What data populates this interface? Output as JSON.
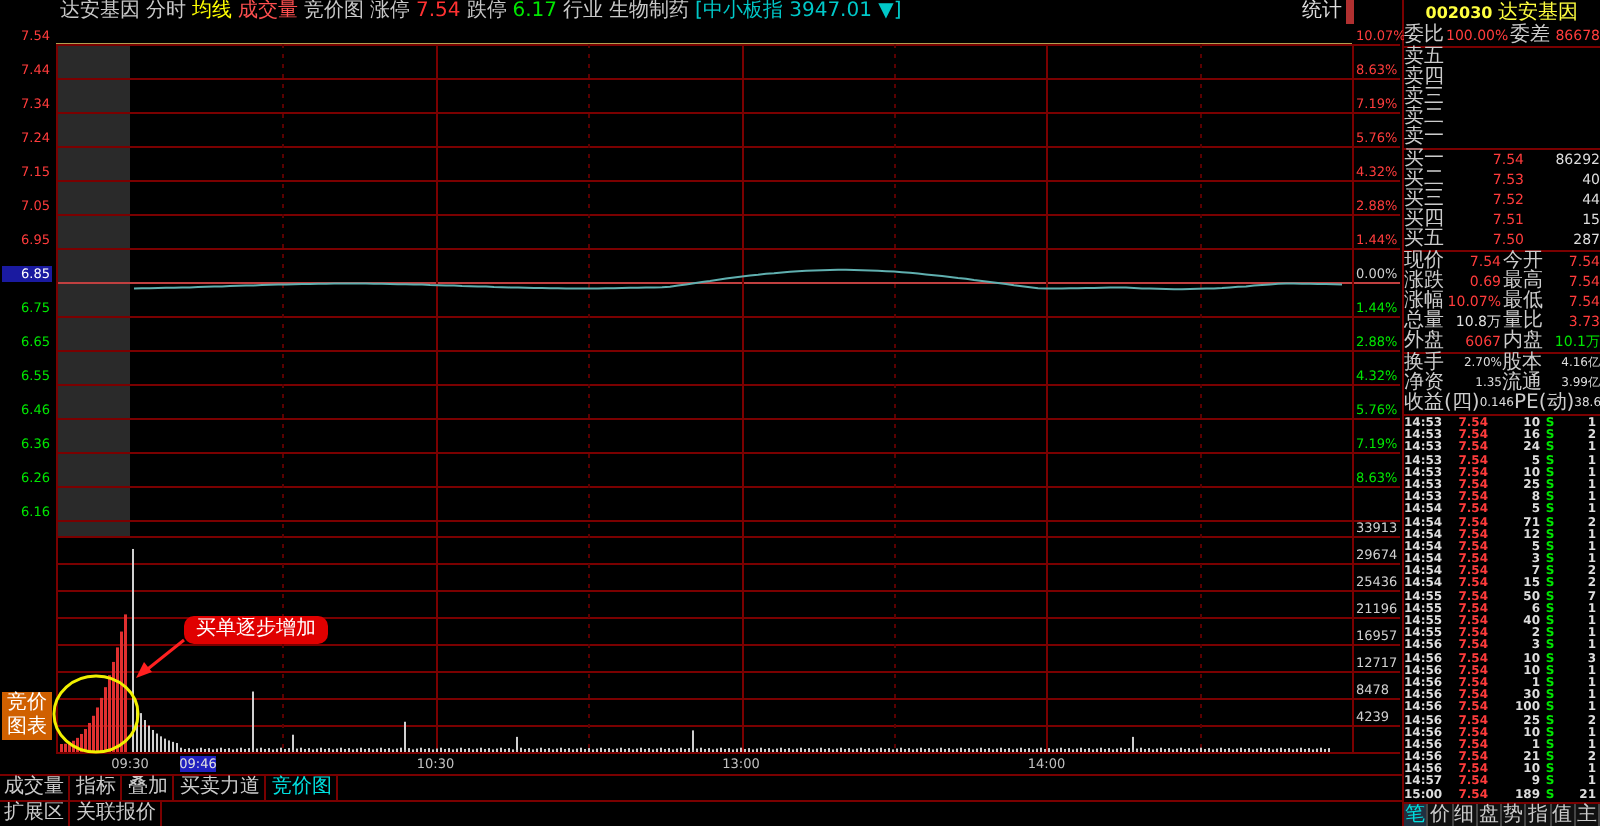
{
  "top_bar": [
    {
      "text": "达安基因",
      "color": "#c8c8c8"
    },
    {
      "text": "分时",
      "color": "#c8c8c8"
    },
    {
      "text": "均线",
      "color": "#ffff00"
    },
    {
      "text": "成交量",
      "color": "#ff5050"
    },
    {
      "text": "竞价图",
      "color": "#c8c8c8"
    },
    {
      "text": "涨停",
      "color": "#c8c8c8"
    },
    {
      "text": "7.54",
      "color": "#ff3232"
    },
    {
      "text": "跌停",
      "color": "#c8c8c8"
    },
    {
      "text": "6.17",
      "color": "#00e600"
    },
    {
      "text": "行业",
      "color": "#c8c8c8"
    },
    {
      "text": "生物制药",
      "color": "#c8c8c8"
    },
    {
      "text": "[中小板指 3947.01 ▼]",
      "color": "#00c8c8"
    }
  ],
  "stats_button": "统计",
  "price_axis": {
    "left": [
      {
        "text": "7.54",
        "kind": "up",
        "highlighted": false
      },
      {
        "text": "7.44",
        "kind": "up",
        "highlighted": false
      },
      {
        "text": "7.34",
        "kind": "up",
        "highlighted": false
      },
      {
        "text": "7.24",
        "kind": "up",
        "highlighted": false
      },
      {
        "text": "7.15",
        "kind": "up",
        "highlighted": false
      },
      {
        "text": "7.05",
        "kind": "up",
        "highlighted": false
      },
      {
        "text": "6.95",
        "kind": "up",
        "highlighted": false
      },
      {
        "text": "6.85",
        "kind": "flat",
        "highlighted": true
      },
      {
        "text": "6.75",
        "kind": "down",
        "highlighted": false
      },
      {
        "text": "6.65",
        "kind": "down",
        "highlighted": false
      },
      {
        "text": "6.55",
        "kind": "down",
        "highlighted": false
      },
      {
        "text": "6.46",
        "kind": "down",
        "highlighted": false
      },
      {
        "text": "6.36",
        "kind": "down",
        "highlighted": false
      },
      {
        "text": "6.26",
        "kind": "down",
        "highlighted": false
      },
      {
        "text": "6.16",
        "kind": "down",
        "highlighted": false
      }
    ],
    "right": [
      {
        "text": "10.07%",
        "kind": "up"
      },
      {
        "text": "8.63%",
        "kind": "up"
      },
      {
        "text": "7.19%",
        "kind": "up"
      },
      {
        "text": "5.76%",
        "kind": "up"
      },
      {
        "text": "4.32%",
        "kind": "up"
      },
      {
        "text": "2.88%",
        "kind": "up"
      },
      {
        "text": "1.44%",
        "kind": "up"
      },
      {
        "text": "0.00%",
        "kind": "flat"
      },
      {
        "text": "1.44%",
        "kind": "down"
      },
      {
        "text": "2.88%",
        "kind": "down"
      },
      {
        "text": "4.32%",
        "kind": "down"
      },
      {
        "text": "5.76%",
        "kind": "down"
      },
      {
        "text": "7.19%",
        "kind": "down"
      },
      {
        "text": "8.63%",
        "kind": "down"
      }
    ]
  },
  "volume_axis": [
    "33913",
    "29674",
    "25436",
    "21196",
    "16957",
    "12717",
    "8478",
    "4239"
  ],
  "time_axis": {
    "labels": [
      "09:30",
      "10:30",
      "13:00",
      "14:00"
    ],
    "cursor": "09:46"
  },
  "auction_button": "竞价图表",
  "annotation": "买单逐步增加",
  "indicator_tabs": [
    {
      "label": "成交量",
      "selected": false
    },
    {
      "label": "指标",
      "selected": false
    },
    {
      "label": "叠加",
      "selected": false
    },
    {
      "label": "买卖力道",
      "selected": false
    },
    {
      "label": "竞价图",
      "selected": true
    }
  ],
  "extension_bar": [
    "扩展区",
    "关联报价"
  ],
  "quote_panel": {
    "code": "002030",
    "name": "达安基因",
    "ratio": {
      "label": "委比",
      "value": "100.00%",
      "label2": "委差",
      "value2": "86678"
    },
    "sell": [
      "卖五",
      "卖四",
      "卖三",
      "卖二",
      "卖一"
    ],
    "buy": [
      {
        "label": "买一",
        "price": "7.54",
        "volume": "86292"
      },
      {
        "label": "买二",
        "price": "7.53",
        "volume": "40"
      },
      {
        "label": "买三",
        "price": "7.52",
        "volume": "44"
      },
      {
        "label": "买四",
        "price": "7.51",
        "volume": "15"
      },
      {
        "label": "买五",
        "price": "7.50",
        "volume": "287"
      }
    ],
    "quotes": [
      {
        "label": "现价",
        "value": "7.54",
        "color": "#ff3c3c"
      },
      {
        "label": "今开",
        "value": "7.54",
        "color": "#ff3c3c"
      },
      {
        "label": "涨跌",
        "value": "0.69",
        "color": "#ff3c3c"
      },
      {
        "label": "最高",
        "value": "7.54",
        "color": "#ff3c3c"
      },
      {
        "label": "涨幅",
        "value": "10.07%",
        "color": "#ff3c3c"
      },
      {
        "label": "最低",
        "value": "7.54",
        "color": "#ff3c3c"
      },
      {
        "label": "总量",
        "value": "10.8万",
        "color": "#dddddd"
      },
      {
        "label": "量比",
        "value": "3.73",
        "color": "#ff3c3c"
      },
      {
        "label": "外盘",
        "value": "6067",
        "color": "#ff3c3c"
      },
      {
        "label": "内盘",
        "value": "10.1万",
        "color": "#00e600"
      }
    ],
    "fundamentals": [
      {
        "label": "换手",
        "value": "2.70%",
        "label2": "股本",
        "value2": "4.16亿"
      },
      {
        "label": "净资",
        "value": "1.35",
        "label2": "流通",
        "value2": "3.99亿"
      },
      {
        "label": "收益(四)",
        "value": "0.146",
        "label2": "PE(动)",
        "value2": "38.6"
      }
    ],
    "ticks": [
      {
        "time": "14:53",
        "price": "7.54",
        "volume": "10",
        "side": "S",
        "count": "1"
      },
      {
        "time": "14:53",
        "price": "7.54",
        "volume": "16",
        "side": "S",
        "count": "2"
      },
      {
        "time": "14:53",
        "price": "7.54",
        "volume": "24",
        "side": "S",
        "count": "1"
      },
      {
        "time": "14:53",
        "price": "7.54",
        "volume": "5",
        "side": "S",
        "count": "1"
      },
      {
        "time": "14:53",
        "price": "7.54",
        "volume": "10",
        "side": "S",
        "count": "1"
      },
      {
        "time": "14:53",
        "price": "7.54",
        "volume": "25",
        "side": "S",
        "count": "1"
      },
      {
        "time": "14:53",
        "price": "7.54",
        "volume": "8",
        "side": "S",
        "count": "1"
      },
      {
        "time": "14:54",
        "price": "7.54",
        "volume": "5",
        "side": "S",
        "count": "1"
      },
      {
        "time": "14:54",
        "price": "7.54",
        "volume": "71",
        "side": "S",
        "count": "2"
      },
      {
        "time": "14:54",
        "price": "7.54",
        "volume": "12",
        "side": "S",
        "count": "1"
      },
      {
        "time": "14:54",
        "price": "7.54",
        "volume": "5",
        "side": "S",
        "count": "1"
      },
      {
        "time": "14:54",
        "price": "7.54",
        "volume": "3",
        "side": "S",
        "count": "1"
      },
      {
        "time": "14:54",
        "price": "7.54",
        "volume": "7",
        "side": "S",
        "count": "2"
      },
      {
        "time": "14:54",
        "price": "7.54",
        "volume": "15",
        "side": "S",
        "count": "2"
      },
      {
        "time": "14:55",
        "price": "7.54",
        "volume": "50",
        "side": "S",
        "count": "7"
      },
      {
        "time": "14:55",
        "price": "7.54",
        "volume": "6",
        "side": "S",
        "count": "1"
      },
      {
        "time": "14:55",
        "price": "7.54",
        "volume": "40",
        "side": "S",
        "count": "1"
      },
      {
        "time": "14:55",
        "price": "7.54",
        "volume": "2",
        "side": "S",
        "count": "1"
      },
      {
        "time": "14:56",
        "price": "7.54",
        "volume": "3",
        "side": "S",
        "count": "1"
      },
      {
        "time": "14:56",
        "price": "7.54",
        "volume": "10",
        "side": "S",
        "count": "3"
      },
      {
        "time": "14:56",
        "price": "7.54",
        "volume": "10",
        "side": "S",
        "count": "1"
      },
      {
        "time": "14:56",
        "price": "7.54",
        "volume": "1",
        "side": "S",
        "count": "1"
      },
      {
        "time": "14:56",
        "price": "7.54",
        "volume": "30",
        "side": "S",
        "count": "1"
      },
      {
        "time": "14:56",
        "price": "7.54",
        "volume": "100",
        "side": "S",
        "count": "1"
      },
      {
        "time": "14:56",
        "price": "7.54",
        "volume": "25",
        "side": "S",
        "count": "2"
      },
      {
        "time": "14:56",
        "price": "7.54",
        "volume": "10",
        "side": "S",
        "count": "1"
      },
      {
        "time": "14:56",
        "price": "7.54",
        "volume": "1",
        "side": "S",
        "count": "1"
      },
      {
        "time": "14:56",
        "price": "7.54",
        "volume": "21",
        "side": "S",
        "count": "2"
      },
      {
        "time": "14:56",
        "price": "7.54",
        "volume": "10",
        "side": "S",
        "count": "1"
      },
      {
        "time": "14:57",
        "price": "7.54",
        "volume": "9",
        "side": "S",
        "count": "1"
      },
      {
        "time": "15:00",
        "price": "7.54",
        "volume": "189",
        "side": "S",
        "count": "21"
      }
    ],
    "tabs": [
      {
        "label": "笔",
        "selected": true
      },
      {
        "label": "价",
        "selected": false
      },
      {
        "label": "细",
        "selected": false
      },
      {
        "label": "盘",
        "selected": false
      },
      {
        "label": "势",
        "selected": false
      },
      {
        "label": "指",
        "selected": false
      },
      {
        "label": "值",
        "selected": false
      },
      {
        "label": "主",
        "selected": false
      }
    ]
  }
}
